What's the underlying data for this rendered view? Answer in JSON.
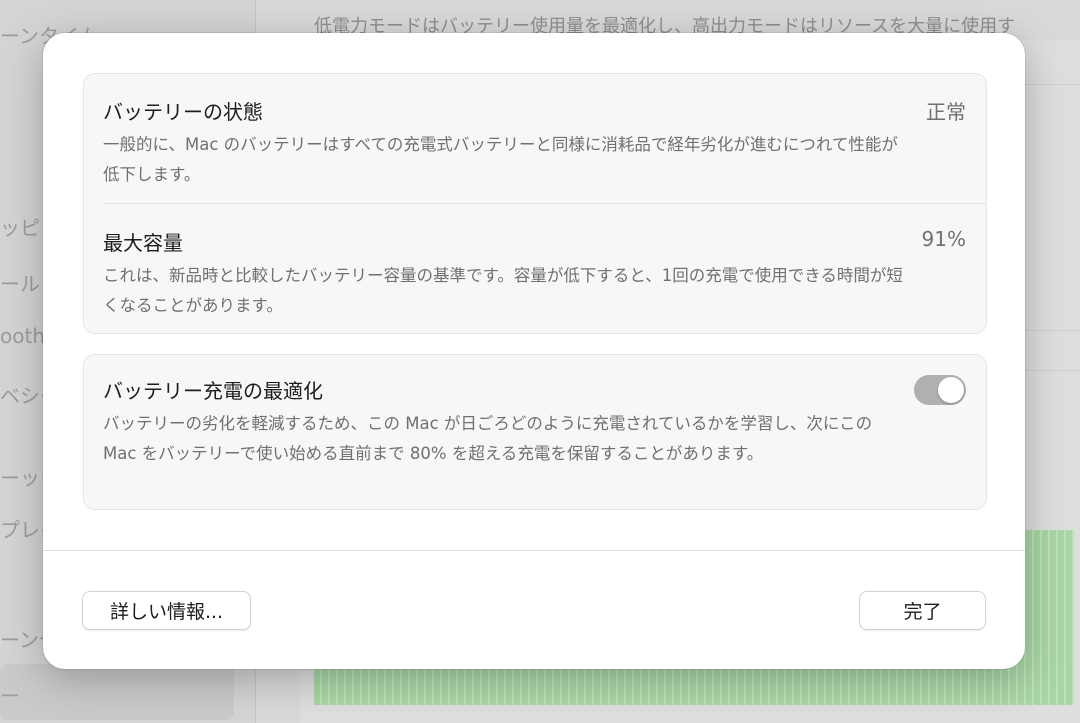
{
  "background": {
    "top_text": "低電力モードはバッテリー使用量を最適化し、高出力モードはリソースを大量に使用す",
    "sidebar_fragments": [
      "ーンタイム",
      "ッピリ",
      "ール",
      "ooth",
      "ベシー",
      "ーップ",
      "プレイ",
      "ーンセ",
      "ー"
    ]
  },
  "dialog": {
    "battery_health": {
      "title": "バッテリーの状態",
      "value": "正常",
      "description": "一般的に、Mac のバッテリーはすべての充電式バッテリーと同様に消耗品で経年劣化が進むにつれて性能が低下します。"
    },
    "max_capacity": {
      "title": "最大容量",
      "value": "91%",
      "description": "これは、新品時と比較したバッテリー容量の基準です。容量が低下すると、1回の充電で使用できる時間が短くなることがあります。"
    },
    "optimized_charging": {
      "title": "バッテリー充電の最適化",
      "enabled": true,
      "description": "バッテリーの劣化を軽減するため、この Mac が日ごろどのように充電されているかを学習し、次にこの Mac をバッテリーで使い始める直前まで 80% を超える充電を保留することがあります。"
    },
    "buttons": {
      "more_info": "詳しい情報...",
      "done": "完了"
    }
  },
  "colors": {
    "toggle_on": "#b0b0b0",
    "chart_green": "#9fd49b"
  }
}
